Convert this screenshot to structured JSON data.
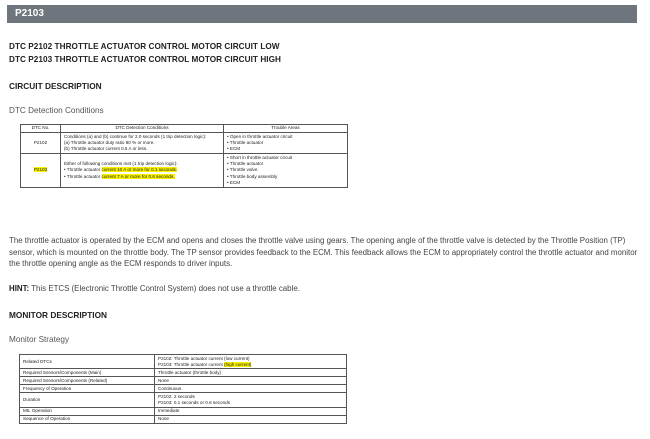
{
  "header": {
    "title": "P2103"
  },
  "titles": {
    "line1": "DTC P2102 THROTTLE ACTUATOR CONTROL MOTOR CIRCUIT LOW",
    "line2": "DTC P2103 THROTTLE ACTUATOR CONTROL MOTOR CIRCUIT HIGH"
  },
  "circuit": {
    "heading": "CIRCUIT DESCRIPTION",
    "subheading": "DTC Detection Conditions",
    "table": {
      "headers": [
        "DTC No.",
        "DTC Detection Conditions",
        "Trouble Areas"
      ],
      "row1": {
        "code": "P2102",
        "cond1": "Conditions (a) and (b) continue for 2.0 seconds (1 trip detection logic):",
        "cond2": "(a) Throttle actuator duty ratio 80 % or more.",
        "cond3": "(b) Throttle actuator current 0.5 A or less.",
        "areas": [
          "• Open in throttle actuator circuit",
          "• Throttle actuator",
          "• ECM"
        ]
      },
      "row2": {
        "code": "P2103",
        "cond0": "Either of following conditions met (1 trip detection logic):",
        "cond1_pre": "• Throttle actuator ",
        "cond1_hl": "current 10 A or more for 0.1 seconds.",
        "cond2_pre": "• Throttle actuator ",
        "cond2_hl": "current 7 A or more for 0.6 seconds.",
        "areas": [
          "• Short in throttle actuator circuit",
          "• Throttle actuator",
          "• Throttle valve",
          "• Throttle body assembly",
          "• ECM"
        ]
      }
    }
  },
  "description": "The throttle actuator is operated by the ECM and opens and closes the throttle valve using gears. The opening angle of the throttle valve is detected by the Throttle Position (TP) sensor, which is mounted on the throttle body. The TP sensor provides feedback to the ECM. This feedback allows the ECM to appropriately control the throttle actuator and monitor the throttle opening angle as the ECM responds to driver inputs.",
  "hint": {
    "label": "HINT:",
    "text": " This ETCS (Electronic Throttle Control System) does not use a throttle cable."
  },
  "monitor": {
    "heading": "MONITOR DESCRIPTION",
    "subheading": "Monitor Strategy",
    "table": {
      "related_label": "Related DTCs",
      "related_1": "P2102: Throttle actuator current (low current)",
      "related_2_pre": "P2103: Throttle actuator current ",
      "related_2_hl": "(high current)",
      "main_label": "Required Sensors/Components (Main)",
      "main_val": "Throttle actuator (throttle body)",
      "rel_label": "Required Sensors/Components (Related)",
      "rel_val": "None",
      "freq_label": "Frequency of Operation",
      "freq_val": "Continuous",
      "dur_label": "Duration",
      "dur_1": "P2102: 2 seconds",
      "dur_2": "P2103: 0.1 seconds or 0.6 seconds",
      "mil_label": "MIL Operation",
      "mil_val": "Immediate",
      "seq_label": "Sequence of Operation",
      "seq_val": "None"
    }
  }
}
